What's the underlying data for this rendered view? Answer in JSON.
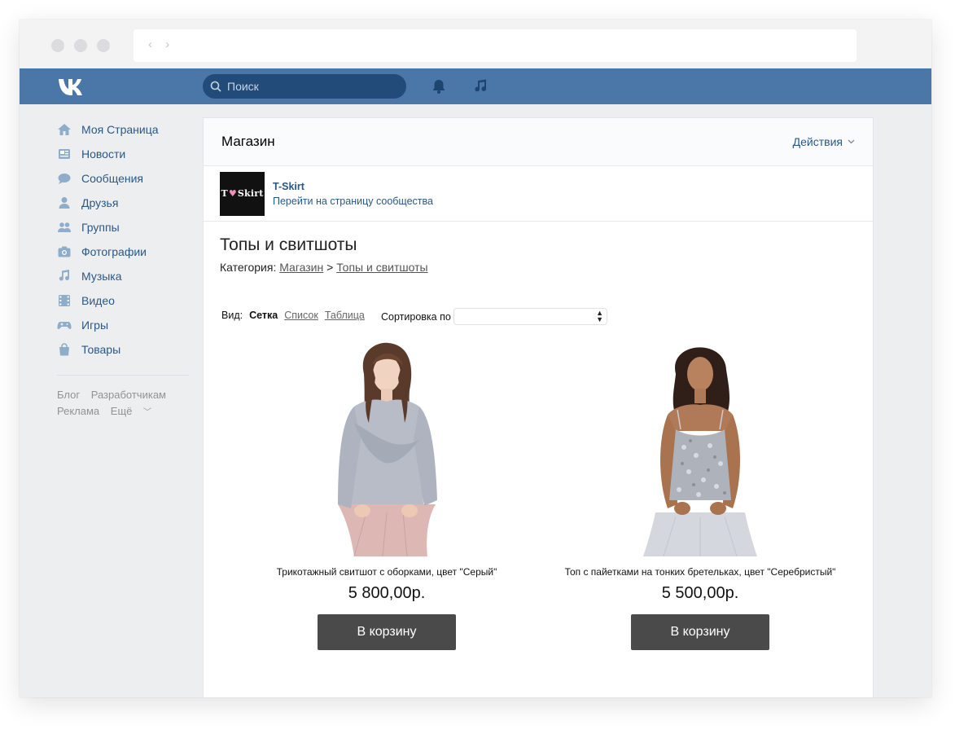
{
  "header": {
    "search_placeholder": "Поиск"
  },
  "sidebar": {
    "items": [
      {
        "label": "Моя Страница",
        "icon": "home-icon"
      },
      {
        "label": "Новости",
        "icon": "news-icon"
      },
      {
        "label": "Сообщения",
        "icon": "messages-icon"
      },
      {
        "label": "Друзья",
        "icon": "friends-icon"
      },
      {
        "label": "Группы",
        "icon": "groups-icon"
      },
      {
        "label": "Фотографии",
        "icon": "camera-icon"
      },
      {
        "label": "Музыка",
        "icon": "music-icon"
      },
      {
        "label": "Видео",
        "icon": "video-icon"
      },
      {
        "label": "Игры",
        "icon": "gamepad-icon"
      },
      {
        "label": "Товары",
        "icon": "shopping-bag-icon"
      }
    ],
    "footer": {
      "blog": "Блог",
      "developers": "Разработчикам",
      "ads": "Реклама",
      "more": "Ещё"
    }
  },
  "shop": {
    "title": "Магазин",
    "actions_label": "Действия",
    "community": {
      "logo_left": "T",
      "logo_right": "Skirt",
      "name": "T-Skirt",
      "link": "Перейти на страницу сообщества"
    },
    "category_title": "Топы и свитшоты",
    "breadcrumb": {
      "prefix": "Категория:",
      "root": "Магазин",
      "separator": ">",
      "current": "Топы и свитшоты"
    },
    "view": {
      "label": "Вид:",
      "grid": "Сетка",
      "list": "Список",
      "table": "Таблица"
    },
    "sort_label": "Сортировка по",
    "sort_value": "",
    "products": [
      {
        "name": "Трикотажный свитшот с оборками, цвет \"Серый\"",
        "price": "5 800,00р.",
        "button": "В корзину"
      },
      {
        "name": "Топ с пайетками на тонких бретельках, цвет \"Серебристый\"",
        "price": "5 500,00р.",
        "button": "В корзину"
      }
    ]
  },
  "colors": {
    "header_blue": "#4a76a8",
    "search_bg": "#224b7a",
    "link_blue": "#2a5885",
    "page_bg": "#edeef0",
    "button_dark": "#4a4a4a"
  }
}
